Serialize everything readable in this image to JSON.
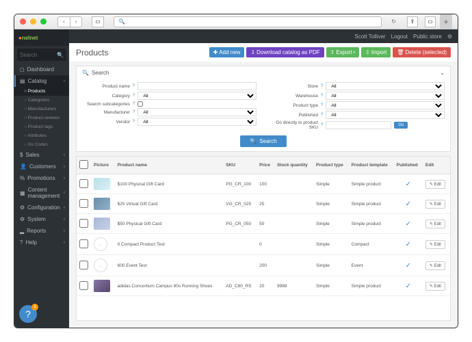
{
  "browser": {
    "search_placeholder": "Q"
  },
  "topbar": {
    "user": "Scott Tolliver",
    "logout": "Logout",
    "public_store": "Public store"
  },
  "logo": "nelnet",
  "sidebar": {
    "search_placeholder": "Search",
    "items": [
      {
        "icon": "◻",
        "label": "Dashboard"
      },
      {
        "icon": "▤",
        "label": "Catalog",
        "expanded": true,
        "subs": [
          {
            "label": "Products",
            "active": true
          },
          {
            "label": "Categories"
          },
          {
            "label": "Manufacturers"
          },
          {
            "label": "Product reviews"
          },
          {
            "label": "Product tags"
          },
          {
            "label": "Attributes"
          },
          {
            "label": "Gs Codes"
          }
        ]
      },
      {
        "icon": "$",
        "label": "Sales"
      },
      {
        "icon": "👤",
        "label": "Customers"
      },
      {
        "icon": "%",
        "label": "Promotions"
      },
      {
        "icon": "▦",
        "label": "Content management"
      },
      {
        "icon": "⚙",
        "label": "Configuration"
      },
      {
        "icon": "⚙",
        "label": "System"
      },
      {
        "icon": "▂",
        "label": "Reports"
      },
      {
        "icon": "?",
        "label": "Help"
      }
    ]
  },
  "page": {
    "title": "Products",
    "actions": {
      "add_new": "Add new",
      "download_pdf": "Download catalog as PDF",
      "export": "Export",
      "import": "Import",
      "delete": "Delete (selected)"
    }
  },
  "search": {
    "heading": "Search",
    "labels": {
      "product_name": "Product name",
      "category": "Category",
      "search_subcategories": "Search subcategories",
      "manufacturer": "Manufacturer",
      "vendor": "Vendor",
      "store": "Store",
      "warehouse": "Warehouse",
      "product_type": "Product type",
      "published": "Published",
      "go_sku": "Go directly to product SKU"
    },
    "all": "All",
    "go": "Go",
    "button": "Search"
  },
  "table": {
    "headers": {
      "picture": "Picture",
      "product_name": "Product name",
      "sku": "SKU",
      "price": "Price",
      "stock": "Stock quantity",
      "product_type": "Product type",
      "template": "Product template",
      "published": "Published",
      "edit": "Edit"
    },
    "edit_label": "Edit",
    "rows": [
      {
        "name": "$100 Physical Gift Card",
        "sku": "PG_CR_100",
        "price": "100",
        "stock": "",
        "ptype": "Simple",
        "template": "Simple product",
        "published": true,
        "thumb": "v1"
      },
      {
        "name": "$25 Virtual Gift Card",
        "sku": "VG_CR_025",
        "price": "25",
        "stock": "",
        "ptype": "Simple",
        "template": "Simple product",
        "published": true,
        "thumb": "v2"
      },
      {
        "name": "$50 Physical Gift Card",
        "sku": "PG_CR_050",
        "price": "50",
        "stock": "",
        "ptype": "Simple",
        "template": "Simple product",
        "published": true,
        "thumb": "v3"
      },
      {
        "name": "0 Compact Product Test",
        "sku": "",
        "price": "0",
        "stock": "",
        "ptype": "Simple",
        "template": "Compact",
        "published": true,
        "thumb": "v4"
      },
      {
        "name": "600 Event Test",
        "sku": "",
        "price": "200",
        "stock": "",
        "ptype": "Simple",
        "template": "Event",
        "published": true,
        "thumb": "v4"
      },
      {
        "name": "adidas Consortium Campus 80s Running Shoes",
        "sku": "AD_C80_RS",
        "price": "20",
        "stock": "9998",
        "ptype": "Simple",
        "template": "Simple product",
        "published": true,
        "thumb": "v5"
      }
    ]
  },
  "help_badge": "1"
}
